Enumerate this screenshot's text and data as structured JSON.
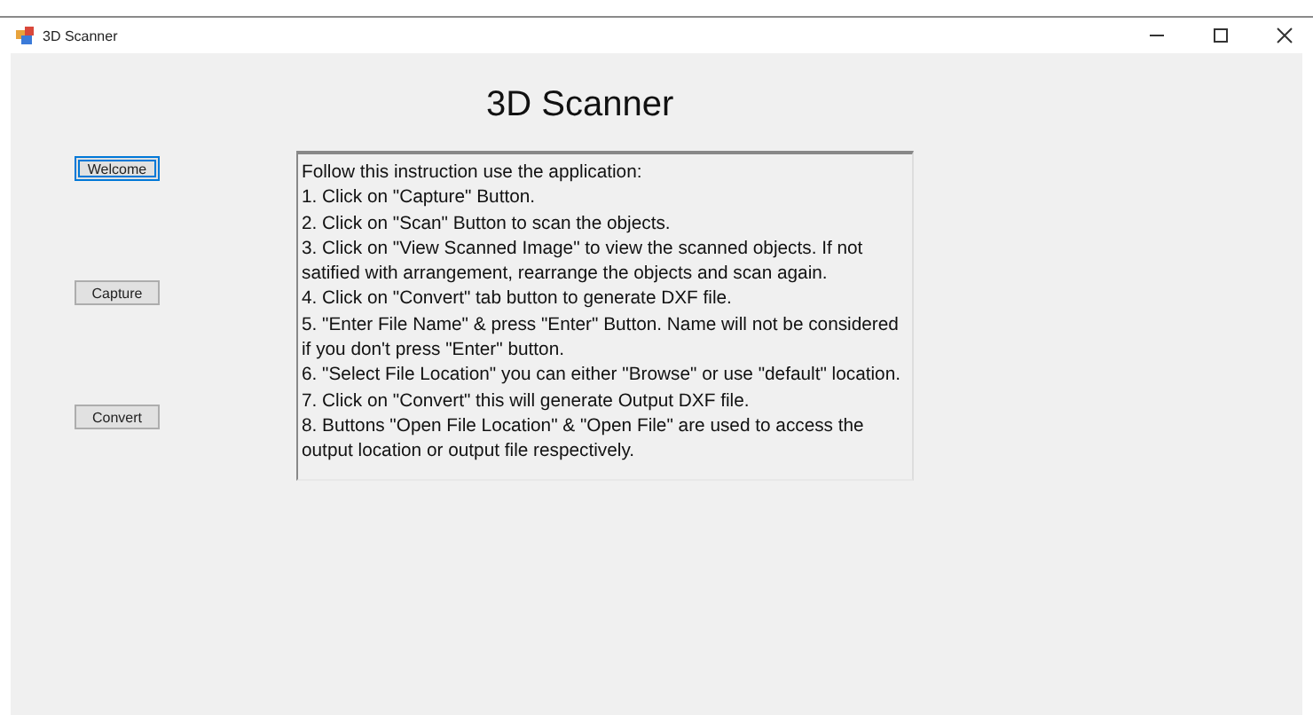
{
  "window": {
    "title": "3D Scanner"
  },
  "nav_buttons": [
    {
      "label": "Welcome",
      "selected": true
    },
    {
      "label": "Capture",
      "selected": false
    },
    {
      "label": "Convert",
      "selected": false
    }
  ],
  "heading": "3D Scanner",
  "instructions": [
    "Follow this instruction use the application:",
    "1. Click on \"Capture\" Button.",
    "2. Click on \"Scan\" Button to scan the objects.",
    "3. Click on \"View Scanned Image\" to view the scanned objects. If not",
    "satified with arrangement, rearrange the objects and scan again.",
    "4. Click on \"Convert\" tab button to generate DXF file.",
    "5. \"Enter File Name\" & press \"Enter\" Button. Name will not be considered",
    "if you don't press \"Enter\" button.",
    "6. \"Select File Location\" you can either \"Browse\" or use \"default\" location.",
    "7. Click on \"Convert\" this will generate Output DXF file.",
    "8. Buttons \"Open File Location\" & \"Open File\" are used to access the",
    "output location or output file respectively."
  ]
}
